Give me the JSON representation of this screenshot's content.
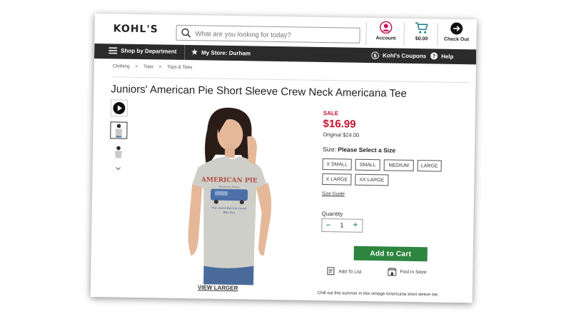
{
  "header": {
    "logo": "KOHL'S",
    "search_placeholder": "What are you looking for today?",
    "account_label": "Account",
    "cart_amount": "$0.00",
    "checkout_label": "Check Out"
  },
  "nav": {
    "shop_label": "Shop by Department",
    "store_label": "My Store: Durham",
    "coupons_label": "Kohl's Coupons",
    "help_label": "Help"
  },
  "breadcrumb": [
    "Clothing",
    ">",
    "Tops",
    ">",
    "Tops & Tees"
  ],
  "product": {
    "title": "Juniors' American Pie Short Sleeve Crew Neck Americana Tee",
    "sale_label": "SALE",
    "sale_price": "$16.99",
    "original_price": "Original $24.00",
    "size_prefix": "Size:",
    "size_prompt": "Please Select a Size",
    "sizes": [
      "X SMALL",
      "SMALL",
      "MEDIUM",
      "LARGE",
      "X LARGE",
      "XX LARGE"
    ],
    "size_guide": "Size Guide",
    "quantity_label": "Quantity",
    "quantity_value": "1",
    "add_to_cart": "Add to Cart",
    "add_to_list": "Add To List",
    "find_in_store": "Find In Store",
    "view_larger": "VIEW LARGER",
    "description": "Chill out this summer in this vintage Americana short sleeve tee.",
    "shirt_print_line1": "AMERICAN PIE",
    "shirt_print_line2": "Drove my Chevy",
    "shirt_print_line3": "The Levee But the Levee",
    "shirt_print_line4": "Was Dry"
  },
  "colors": {
    "sale_red": "#c8102e",
    "cart_green": "#2e8540",
    "nav_dark": "#2b2b2b",
    "account_pink": "#c2185b",
    "cart_teal": "#1b7f8c"
  },
  "icons": [
    "search-icon",
    "account-icon",
    "cart-icon",
    "checkout-arrow-icon",
    "menu-icon",
    "star-icon",
    "coupon-icon",
    "help-icon",
    "play-icon",
    "chevron-down-icon",
    "list-icon",
    "store-icon"
  ]
}
